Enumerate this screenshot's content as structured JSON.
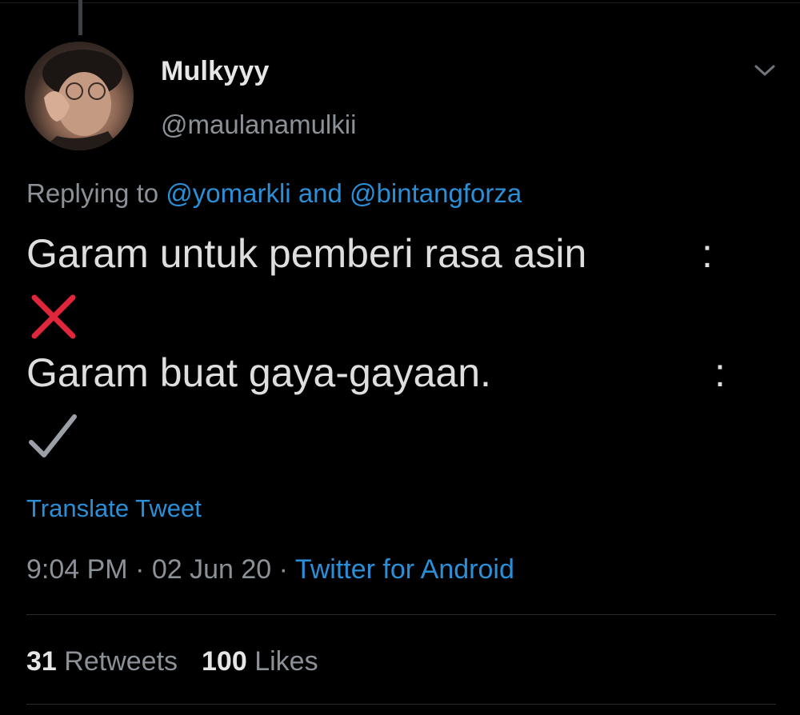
{
  "tweet": {
    "author": {
      "display_name": "Mulkyyy",
      "handle": "@maulanamulkii"
    },
    "replying_to": {
      "prefix": "Replying to",
      "mention_1": "@yomarkli",
      "conjunction": "and",
      "mention_2": "@bintangforza"
    },
    "body": {
      "line_1": "Garam untuk pemberi rasa asin",
      "line_1_colon": ":",
      "line_2": "Garam buat gaya-gayaan.",
      "line_2_colon": ":"
    },
    "icons": {
      "menu": "chevron-down-icon",
      "cross": "cross-mark-icon",
      "check": "check-mark-icon"
    },
    "translate_label": "Translate Tweet",
    "meta": {
      "time": "9:04 PM",
      "separator": "·",
      "date": "02 Jun 20",
      "source": "Twitter for Android"
    },
    "stats": {
      "retweets_count": "31",
      "retweets_label": "Retweets",
      "likes_count": "100",
      "likes_label": "Likes"
    }
  },
  "colors": {
    "background": "#000000",
    "link": "#2b8fd8",
    "secondary_text": "#8b9197",
    "primary_text": "#dedede",
    "cross": "#e0263a",
    "check": "#9aa0a6"
  }
}
